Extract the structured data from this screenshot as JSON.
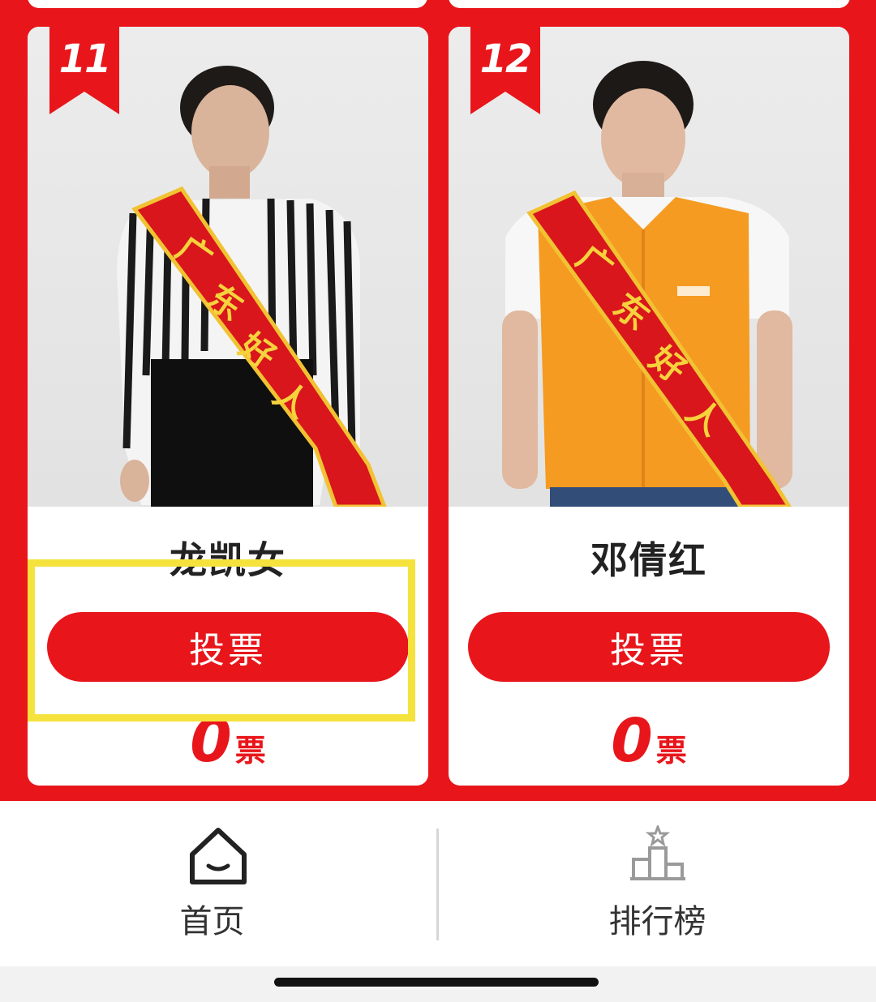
{
  "candidates": [
    {
      "number": "11",
      "name": "龙凯女",
      "vote_label": "投票",
      "votes": "0",
      "votes_unit": "票"
    },
    {
      "number": "12",
      "name": "邓倩红",
      "vote_label": "投票",
      "votes": "0",
      "votes_unit": "票"
    }
  ],
  "sash_text": "广东好人",
  "tabbar": {
    "home_label": "首页",
    "rank_label": "排行榜"
  },
  "colors": {
    "brand_red": "#e8161b",
    "highlight_yellow": "#f5e23c"
  },
  "icons": {
    "home": "home-icon",
    "rank": "podium-icon"
  }
}
